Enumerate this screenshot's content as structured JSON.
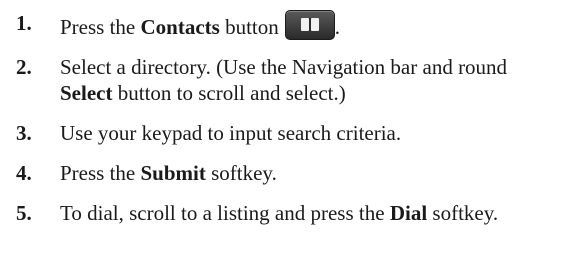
{
  "steps": [
    {
      "num": "1.",
      "parts": [
        "Press the ",
        "Contacts",
        " button",
        "."
      ],
      "icon": "contacts-book-icon"
    },
    {
      "num": "2.",
      "parts": [
        "Select a directory. (Use the Navigation bar and round ",
        "Select",
        " button to scroll and select.)"
      ]
    },
    {
      "num": "3.",
      "parts": [
        "Use your keypad to input search criteria."
      ]
    },
    {
      "num": "4.",
      "parts": [
        "Press the ",
        "Submit",
        " softkey."
      ]
    },
    {
      "num": "5.",
      "parts": [
        "To dial, scroll to a listing and press the ",
        "Dial",
        " softkey."
      ]
    }
  ],
  "colors": {
    "text": "#1a1a1a",
    "button_bg": "#3a3a3a",
    "icon_fill": "#f0f0f0"
  }
}
